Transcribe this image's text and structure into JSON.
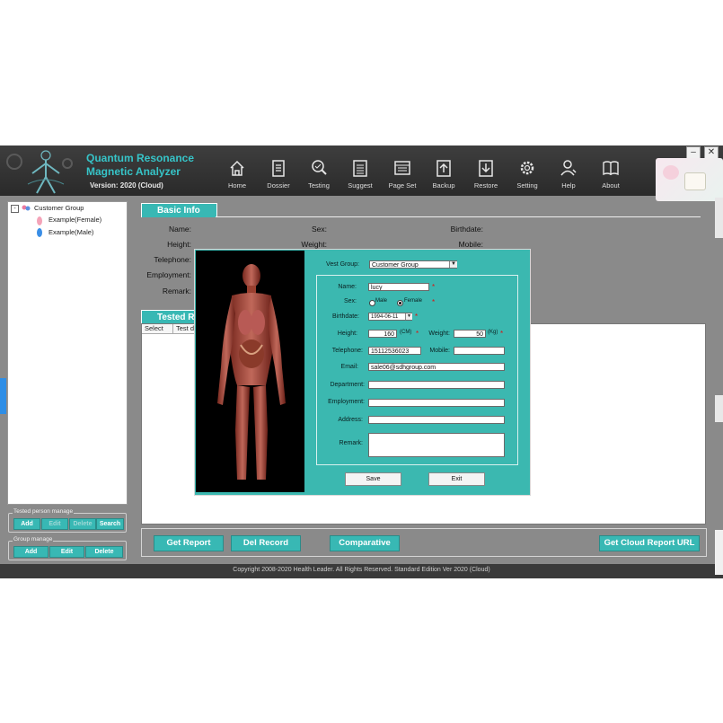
{
  "app": {
    "title_line1": "Quantum Resonance",
    "title_line2": "Magnetic Analyzer",
    "version": "Version: 2020 (Cloud)",
    "close_symbol": "✕"
  },
  "toolbar": [
    {
      "label": "Home",
      "icon": "home-icon"
    },
    {
      "label": "Dossier",
      "icon": "clipboard-icon"
    },
    {
      "label": "Testing",
      "icon": "magnifier-icon"
    },
    {
      "label": "Suggest",
      "icon": "list-icon"
    },
    {
      "label": "Page Set",
      "icon": "page-icon"
    },
    {
      "label": "Backup",
      "icon": "upload-icon"
    },
    {
      "label": "Restore",
      "icon": "download-icon"
    },
    {
      "label": "Setting",
      "icon": "gear-icon"
    },
    {
      "label": "Help",
      "icon": "person-icon"
    },
    {
      "label": "About",
      "icon": "book-icon"
    }
  ],
  "tree": {
    "root": "Customer Group",
    "root_toggle": "-",
    "children": [
      "Example(Female)",
      "Example(Male)"
    ]
  },
  "tested_group": {
    "title": "Tested person manage",
    "buttons": [
      "Add",
      "Edit",
      "Delete",
      "Search"
    ]
  },
  "group_manage": {
    "title": "Group manage",
    "buttons": [
      "Add",
      "Edit",
      "Delete"
    ]
  },
  "basic_info": {
    "tab": "Basic Info",
    "labels": {
      "name": "Name:",
      "sex": "Sex:",
      "birthdate": "Birthdate:",
      "height": "Height:",
      "weight": "Weight:",
      "mobile": "Mobile:",
      "telephone": "Telephone:",
      "employment": "Employment:",
      "remark": "Remark:"
    }
  },
  "tested_records": {
    "tab": "Tested Rec",
    "columns": [
      "Select",
      "Test d"
    ]
  },
  "bottom_buttons": [
    "Get Report",
    "Del Record",
    "Comparative",
    "Get Cloud Report URL"
  ],
  "footer": "Copyright 2008-2020 Health Leader. All Rights Reserved. Standard Edition Ver 2020 (Cloud)",
  "dialog": {
    "vest_group_label": "Vest Group:",
    "vest_group_value": "Customer Group",
    "name_label": "Name:",
    "name_value": "lucy",
    "sex_label": "Sex:",
    "male": "Male",
    "female": "Female",
    "sex_selected": "Female",
    "birthdate_label": "Birthdate:",
    "birthdate_value": "1994-06-11",
    "height_label": "Height:",
    "height_value": "160",
    "height_unit": "(CM)",
    "weight_label": "Weight:",
    "weight_value": "50",
    "weight_unit": "(Kg)",
    "telephone_label": "Telephone:",
    "telephone_value": "15112536023",
    "mobile_label": "Mobile:",
    "mobile_value": "",
    "email_label": "Email:",
    "email_value": "sale06@sdhgroup.com",
    "department_label": "Department:",
    "employment_label": "Employment:",
    "address_label": "Address:",
    "remark_label": "Remark:",
    "required_mark": "*",
    "save": "Save",
    "exit": "Exit"
  },
  "colors": {
    "accent": "#38b8b4",
    "title": "#36c4c8",
    "dialog_bg": "#3bb8b0",
    "header": "#333333",
    "frame": "#8a8a8a"
  }
}
